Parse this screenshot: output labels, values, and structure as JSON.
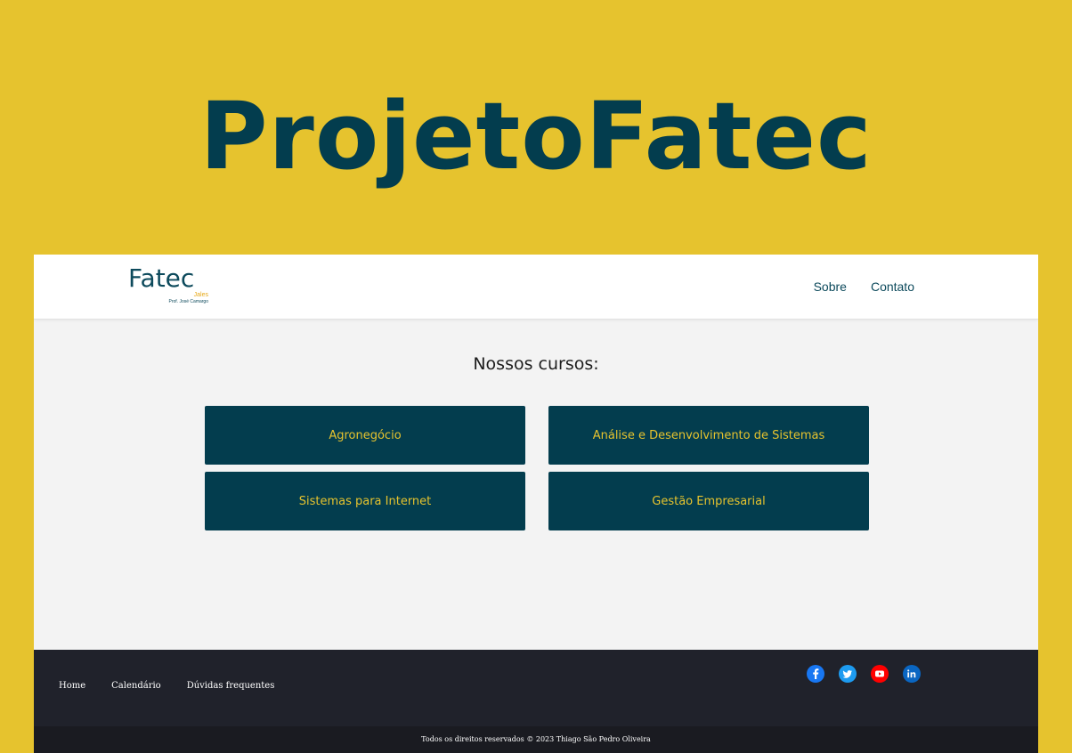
{
  "banner": {
    "title": "ProjetoFatec"
  },
  "navbar": {
    "logo": {
      "main": "Fatec",
      "sub": "Jales",
      "sub2": "Prof. José Camargo"
    },
    "links": [
      {
        "label": "Sobre"
      },
      {
        "label": "Contato"
      }
    ]
  },
  "main": {
    "heading": "Nossos cursos:",
    "courses": [
      {
        "label": "Agronegócio"
      },
      {
        "label": "Análise e Desenvolvimento de Sistemas"
      },
      {
        "label": "Sistemas para Internet"
      },
      {
        "label": "Gestão Empresarial"
      }
    ]
  },
  "footer": {
    "links": [
      {
        "label": "Home"
      },
      {
        "label": "Calendário"
      },
      {
        "label": "Dúvidas frequentes"
      }
    ],
    "social": [
      {
        "icon": "facebook-icon",
        "color": "#1877f2"
      },
      {
        "icon": "twitter-icon",
        "color": "#1d9bf0"
      },
      {
        "icon": "youtube-icon",
        "color": "#ff0000"
      },
      {
        "icon": "linkedin-icon",
        "color": "#0a66c2"
      }
    ],
    "copyright": "Todos os direitos reservados © 2023 Thiago São Pedro Oliveira"
  },
  "colors": {
    "banner_bg": "#e6c32e",
    "primary": "#033d4e",
    "accent": "#e6c32e",
    "footer_bg": "#20222b"
  }
}
